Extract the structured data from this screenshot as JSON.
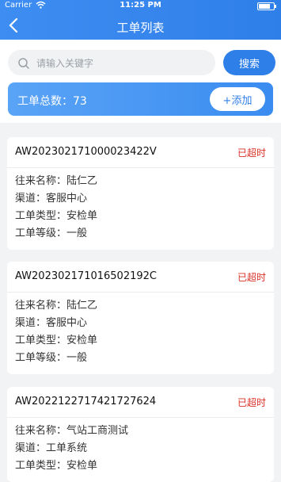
{
  "status_bar": {
    "carrier": "Carrier",
    "time": "11:25 PM"
  },
  "header": {
    "title": "工单列表"
  },
  "search": {
    "placeholder": "请输入关键字",
    "button_label": "搜索"
  },
  "summary": {
    "label": "工单总数：73",
    "add_label": "+添加"
  },
  "colors": {
    "accent": "#2f7fe9",
    "overdue": "#d93025"
  },
  "orders": [
    {
      "code": "AW20230217100002342 2V",
      "status": "已超时",
      "fields": [
        {
          "label": "往来名称：",
          "value": "陆仁乙"
        },
        {
          "label": "渠道：",
          "value": "客服中心"
        },
        {
          "label": "工单类型：",
          "value": "安检单"
        },
        {
          "label": "工单等级：",
          "value": "一般"
        }
      ]
    },
    {
      "code": "AW20230217101650219 2C",
      "status": "已超时",
      "fields": [
        {
          "label": "往来名称：",
          "value": "陆仁乙"
        },
        {
          "label": "渠道：",
          "value": "客服中心"
        },
        {
          "label": "工单类型：",
          "value": "安检单"
        },
        {
          "label": "工单等级：",
          "value": "一般"
        }
      ]
    },
    {
      "code": "AW20221227174217276 24",
      "status": "已超时",
      "fields": [
        {
          "label": "往来名称：",
          "value": "气站工商测试"
        },
        {
          "label": "渠道：",
          "value": "工单系统"
        },
        {
          "label": "工单类型：",
          "value": "安检单"
        }
      ]
    }
  ]
}
